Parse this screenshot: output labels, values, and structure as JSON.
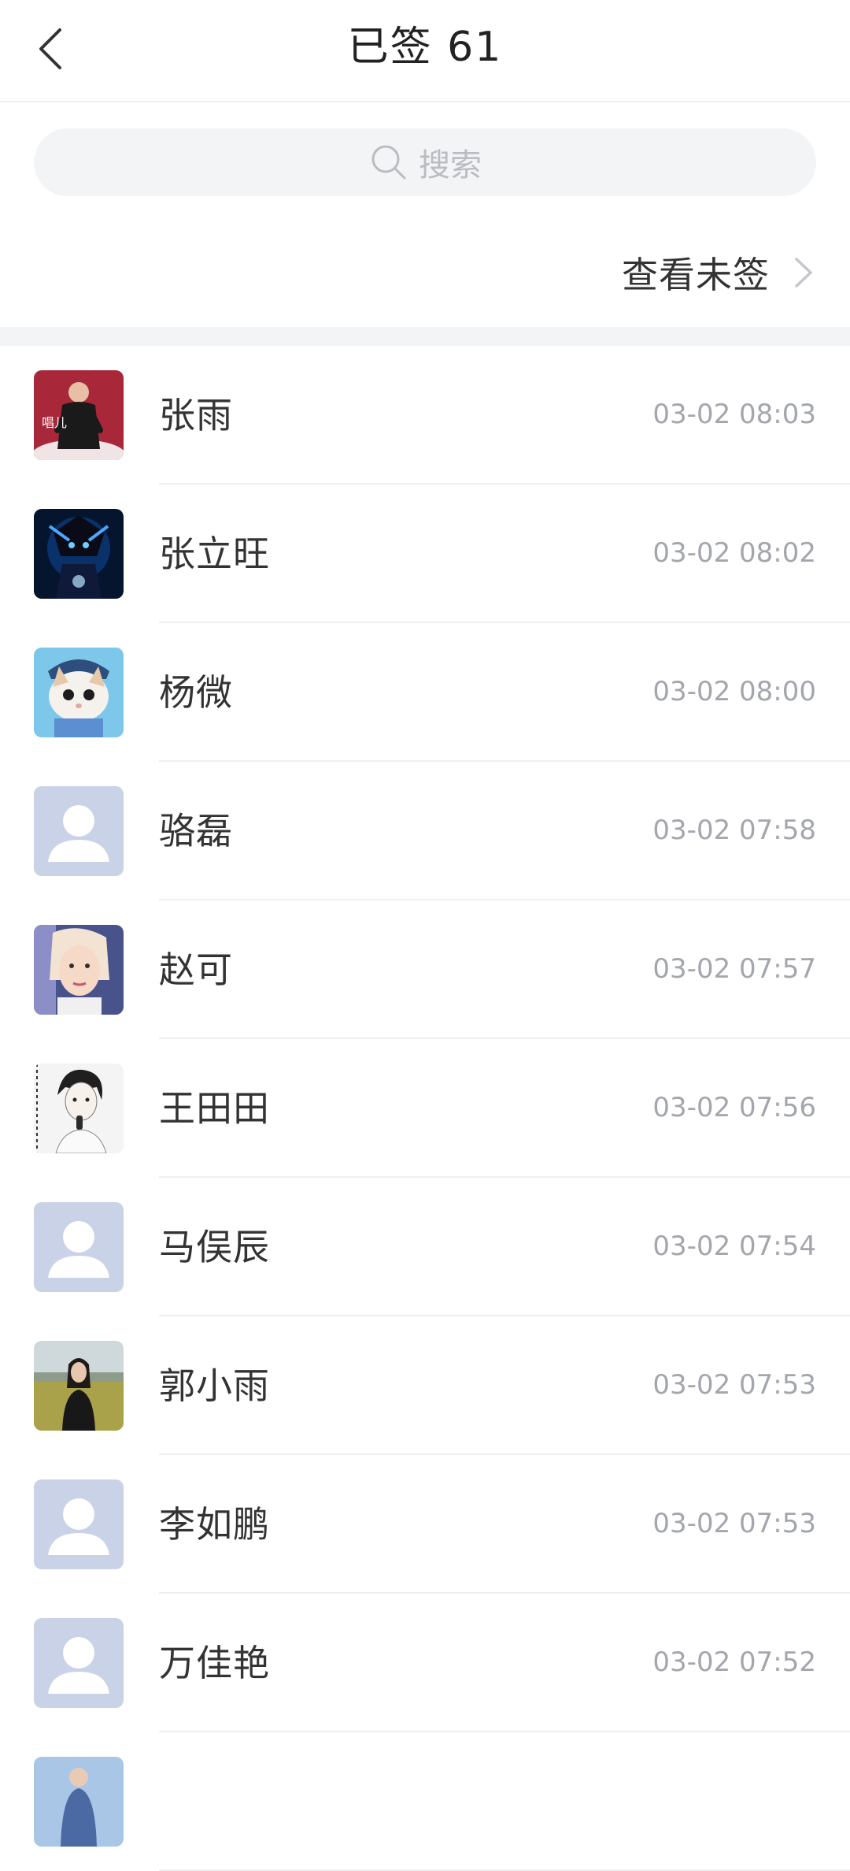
{
  "header": {
    "title": "已签 61",
    "back_icon": "back-arrow-icon"
  },
  "search": {
    "placeholder": "搜索",
    "icon": "search-icon"
  },
  "view_unsigned": {
    "label": "查看未签",
    "icon": "chevron-right-icon"
  },
  "colors": {
    "text_primary": "#333333",
    "text_secondary": "#a3a6ac",
    "background_gray": "#f3f4f6",
    "avatar_placeholder_bg": "#c9d2e6"
  },
  "signed_list": [
    {
      "name": "张雨",
      "time": "03-02 08:03",
      "avatar": "photo"
    },
    {
      "name": "张立旺",
      "time": "03-02 08:02",
      "avatar": "photo"
    },
    {
      "name": "杨微",
      "time": "03-02 08:00",
      "avatar": "photo"
    },
    {
      "name": "骆磊",
      "time": "03-02 07:58",
      "avatar": "default"
    },
    {
      "name": "赵可",
      "time": "03-02 07:57",
      "avatar": "photo"
    },
    {
      "name": "王田田",
      "time": "03-02 07:56",
      "avatar": "photo"
    },
    {
      "name": "马俣辰",
      "time": "03-02 07:54",
      "avatar": "default"
    },
    {
      "name": "郭小雨",
      "time": "03-02 07:53",
      "avatar": "photo"
    },
    {
      "name": "李如鹏",
      "time": "03-02 07:53",
      "avatar": "default"
    },
    {
      "name": "万佳艳",
      "time": "03-02 07:52",
      "avatar": "default"
    },
    {
      "name": "",
      "time": "",
      "avatar": "photo"
    }
  ]
}
